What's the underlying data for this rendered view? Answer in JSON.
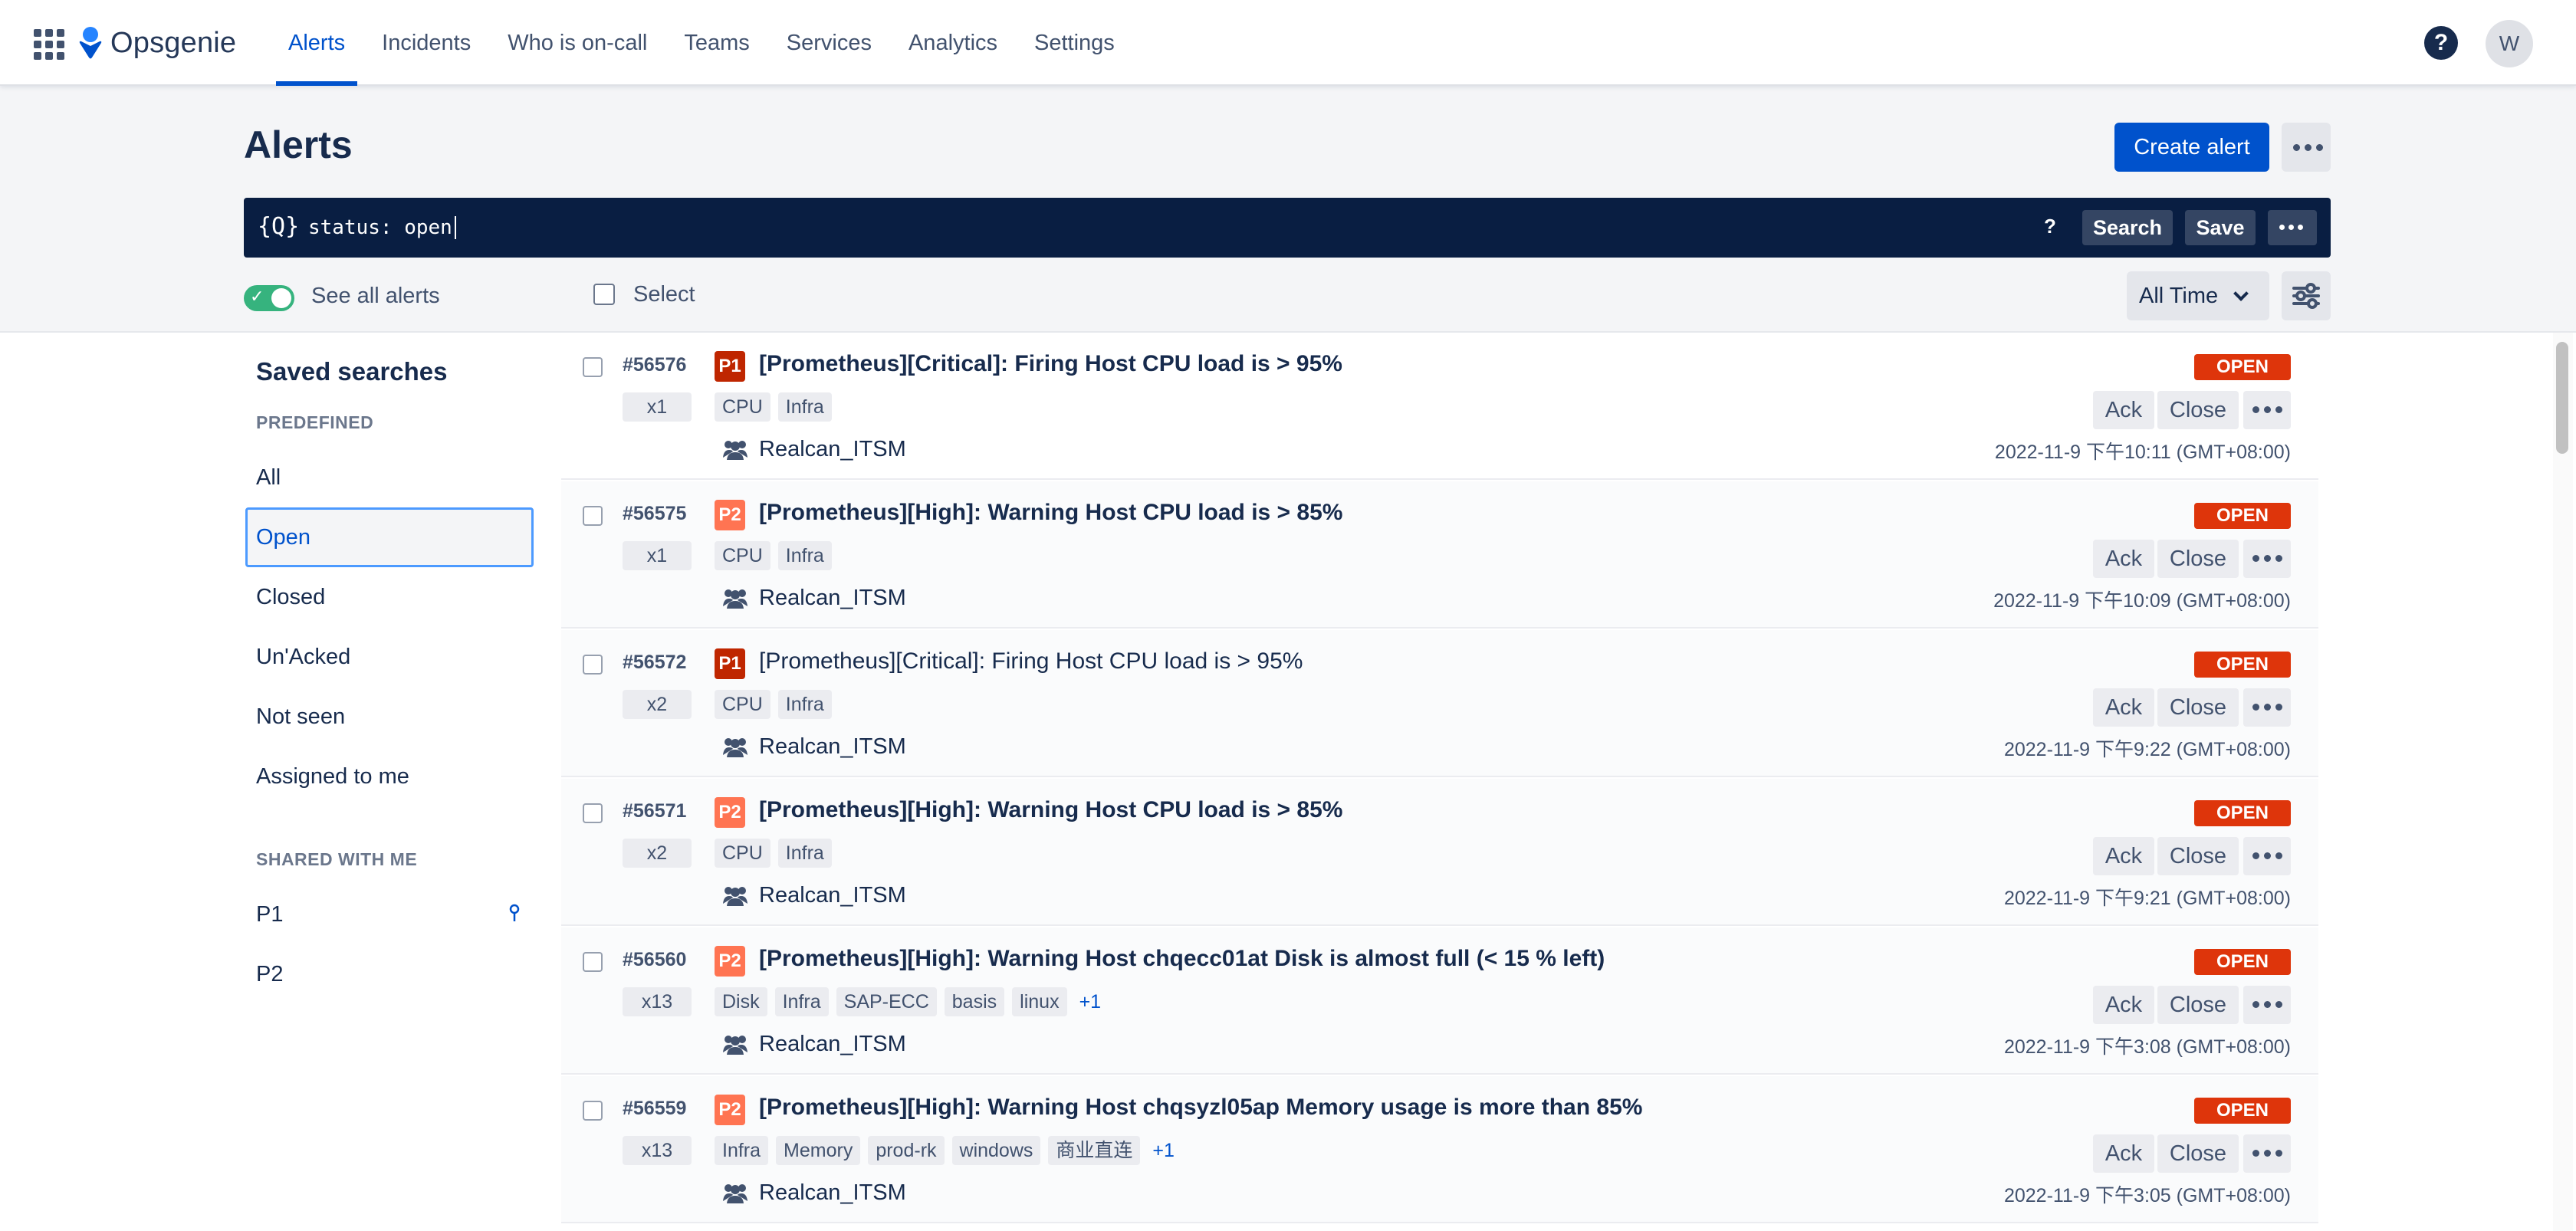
{
  "nav": {
    "logo": "Opsgenie",
    "tabs": [
      {
        "label": "Alerts",
        "active": true
      },
      {
        "label": "Incidents"
      },
      {
        "label": "Who is on-call"
      },
      {
        "label": "Teams"
      },
      {
        "label": "Services"
      },
      {
        "label": "Analytics"
      },
      {
        "label": "Settings"
      }
    ],
    "help": "?",
    "avatar": "W"
  },
  "header": {
    "title": "Alerts",
    "create_label": "Create alert"
  },
  "search": {
    "icon": "{Q}",
    "query": "status: open",
    "help": "?",
    "search_label": "Search",
    "save_label": "Save"
  },
  "filters": {
    "see_all_label": "See all alerts",
    "see_all_on": true,
    "select_label": "Select",
    "time_range": "All Time"
  },
  "sidebar": {
    "heading": "Saved searches",
    "predefined_label": "PREDEFINED",
    "predefined": [
      "All",
      "Open",
      "Closed",
      "Un'Acked",
      "Not seen",
      "Assigned to me"
    ],
    "selected": "Open",
    "shared_label": "SHARED WITH ME",
    "shared": [
      "P1",
      "P2"
    ]
  },
  "actions": {
    "ack": "Ack",
    "close": "Close"
  },
  "alerts": [
    {
      "id": "#56576",
      "count": "x1",
      "priority": "P1",
      "title": "[Prometheus][Critical]: Firing Host CPU load is > 95%",
      "bold": true,
      "tags": [
        "CPU",
        "Infra"
      ],
      "more": "",
      "team": "Realcan_ITSM",
      "status": "OPEN",
      "time": "2022-11-9 下午10:11 (GMT+08:00)"
    },
    {
      "id": "#56575",
      "count": "x1",
      "priority": "P2",
      "title": "[Prometheus][High]: Warning Host CPU load is > 85%",
      "bold": true,
      "tags": [
        "CPU",
        "Infra"
      ],
      "more": "",
      "team": "Realcan_ITSM",
      "status": "OPEN",
      "time": "2022-11-9 下午10:09 (GMT+08:00)"
    },
    {
      "id": "#56572",
      "count": "x2",
      "priority": "P1",
      "title": "[Prometheus][Critical]: Firing Host CPU load is > 95%",
      "bold": false,
      "tags": [
        "CPU",
        "Infra"
      ],
      "more": "",
      "team": "Realcan_ITSM",
      "status": "OPEN",
      "time": "2022-11-9 下午9:22 (GMT+08:00)"
    },
    {
      "id": "#56571",
      "count": "x2",
      "priority": "P2",
      "title": "[Prometheus][High]: Warning Host CPU load is > 85%",
      "bold": true,
      "tags": [
        "CPU",
        "Infra"
      ],
      "more": "",
      "team": "Realcan_ITSM",
      "status": "OPEN",
      "time": "2022-11-9 下午9:21 (GMT+08:00)"
    },
    {
      "id": "#56560",
      "count": "x13",
      "priority": "P2",
      "title": "[Prometheus][High]: Warning Host chqecc01at Disk is almost full (< 15 % left)",
      "bold": true,
      "tags": [
        "Disk",
        "Infra",
        "SAP-ECC",
        "basis",
        "linux"
      ],
      "more": "+1",
      "team": "Realcan_ITSM",
      "status": "OPEN",
      "time": "2022-11-9 下午3:08 (GMT+08:00)"
    },
    {
      "id": "#56559",
      "count": "x13",
      "priority": "P2",
      "title": "[Prometheus][High]: Warning Host chqsyzl05ap Memory usage is more than 85%",
      "bold": true,
      "tags": [
        "Infra",
        "Memory",
        "prod-rk",
        "windows",
        "商业直连"
      ],
      "more": "+1",
      "team": "Realcan_ITSM",
      "status": "OPEN",
      "time": "2022-11-9 下午3:05 (GMT+08:00)"
    }
  ],
  "colors": {
    "brand": "#0052cc",
    "nav_bg": "#091e42",
    "p1": "#bf2600",
    "p2": "#ff7452",
    "open_badge": "#de350b",
    "toggle_on": "#36b37e"
  }
}
